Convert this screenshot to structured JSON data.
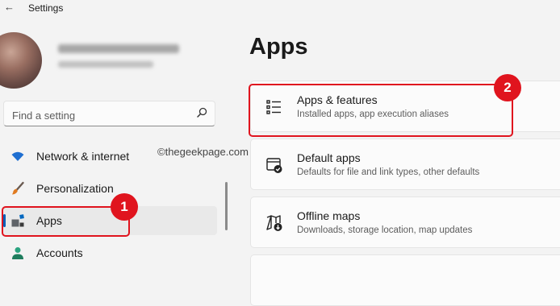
{
  "window": {
    "title": "Settings"
  },
  "search": {
    "placeholder": "Find a setting"
  },
  "nav": {
    "items": [
      {
        "label": "Network & internet"
      },
      {
        "label": "Personalization"
      },
      {
        "label": "Apps"
      },
      {
        "label": "Accounts"
      }
    ]
  },
  "watermark": "©thegeekpage.com",
  "main": {
    "title": "Apps",
    "cards": [
      {
        "title": "Apps & features",
        "description": "Installed apps, app execution aliases"
      },
      {
        "title": "Default apps",
        "description": "Defaults for file and link types, other defaults"
      },
      {
        "title": "Offline maps",
        "description": "Downloads, storage location, map updates"
      }
    ]
  },
  "annotations": {
    "badge1": "1",
    "badge2": "2"
  },
  "colors": {
    "accent": "#005fb8",
    "annotation_red": "#e0141e",
    "wifi_blue": "#1f6fd1"
  }
}
